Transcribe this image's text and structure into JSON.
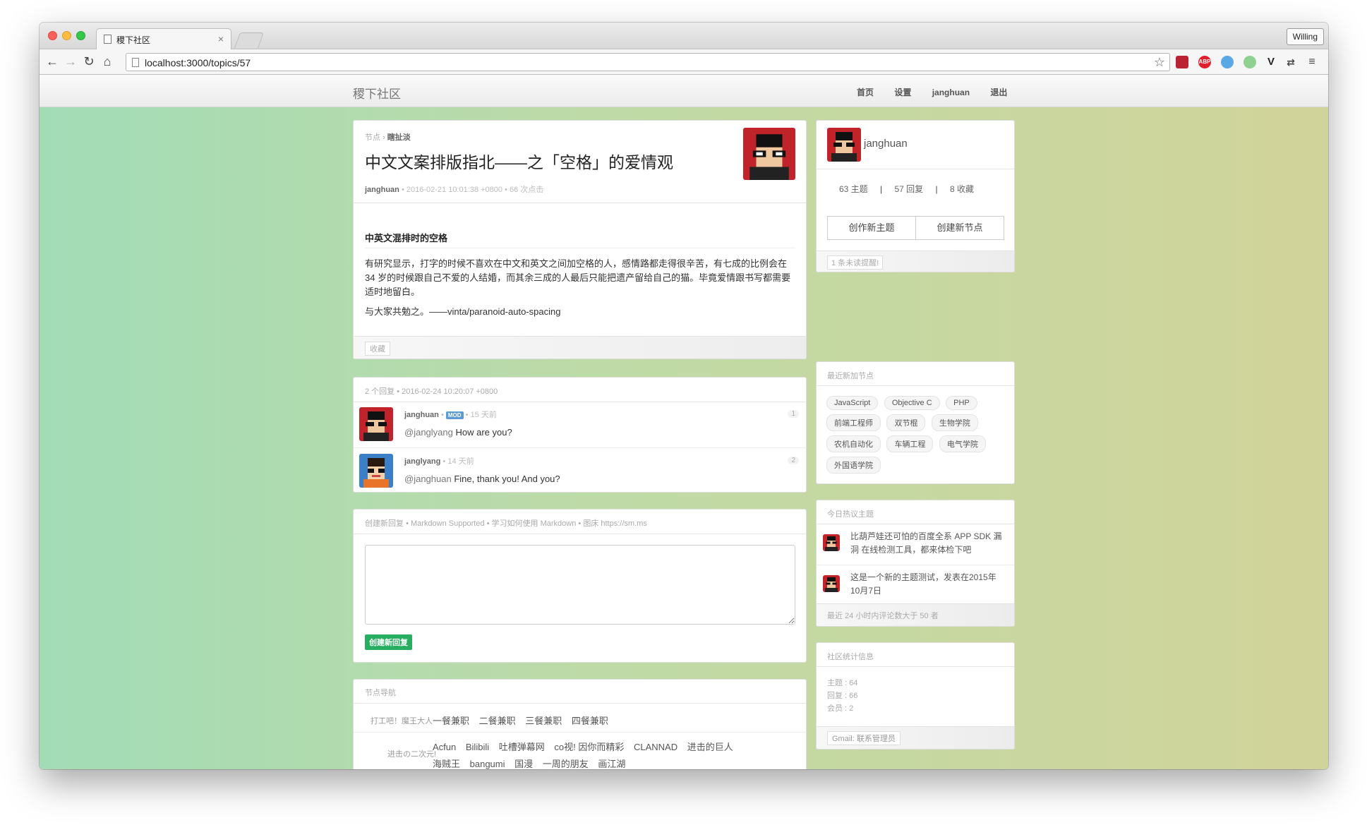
{
  "browser": {
    "tab_title": "稷下社区",
    "tab_close": "×",
    "profile_name": "Willing",
    "url": "localhost:3000/topics/57",
    "ext_labels": [
      "ABP",
      "V"
    ]
  },
  "site": {
    "brand": "稷下社区",
    "nav": [
      "首页",
      "设置",
      "janghuan",
      "退出"
    ]
  },
  "topic": {
    "crumb_root": "节点",
    "crumb_sep": "›",
    "crumb_node": "瞎扯淡",
    "title": "中文文案排版指北——之「空格」的爱情观",
    "author": "janghuan",
    "time": "2016-02-21 10:01:38 +0800",
    "views": "66 次点击",
    "heading": "中英文混排时的空格",
    "para1": "有研究显示，打字的时候不喜欢在中文和英文之间加空格的人，感情路都走得很辛苦，有七成的比例会在 34 岁的时候跟自己不爱的人结婚，而其余三成的人最后只能把遗产留给自己的猫。毕竟爱情跟书写都需要适时地留白。",
    "para2": "与大家共勉之。——vinta/paranoid-auto-spacing",
    "favorite": "收藏"
  },
  "replies": {
    "count": "2 个回复",
    "last_time": "2016-02-24 10:20:07 +0800",
    "items": [
      {
        "user": "janghuan",
        "badge": "MOD",
        "time": "15 天前",
        "mention": "@janglyang",
        "text": " How are you?",
        "num": "1"
      },
      {
        "user": "janglyang",
        "time": "14 天前",
        "mention": "@janghuan",
        "text": " Fine, thank you! And you?",
        "num": "2"
      }
    ]
  },
  "new_reply": {
    "title": "创建新回复",
    "md": "Markdown Supported",
    "learn": "学习如何使用 Markdown",
    "img": "图床 https://sm.ms",
    "submit": "创建新回复"
  },
  "node_nav": {
    "title": "节点导航",
    "groups": [
      {
        "label": "打工吧！魔王大人",
        "links": [
          "一餐兼职",
          "二餐兼职",
          "三餐兼职",
          "四餐兼职"
        ]
      },
      {
        "label": "进击の二次元!",
        "links_line1": [
          "Acfun",
          "Bilibili",
          "吐槽弹幕网",
          "co视! 因你而精彩",
          "CLANNAD",
          "进击的巨人"
        ],
        "links_line2": [
          "海贼王",
          "bangumi",
          "国漫",
          "一周的朋友",
          "画江湖"
        ]
      }
    ]
  },
  "profile": {
    "name": "janghuan",
    "topics": "63 主题",
    "replies": "57 回复",
    "favorites": "8 收藏",
    "sep": "|",
    "new_topic": "创作新主题",
    "new_node": "创建新节点",
    "notice": "1 条未读提醒!"
  },
  "recent_nodes": {
    "title": "最近新加节点",
    "items": [
      "JavaScript",
      "Objective C",
      "PHP",
      "前端工程师",
      "双节棍",
      "生物学院",
      "农机自动化",
      "车辆工程",
      "电气学院",
      "外国语学院"
    ]
  },
  "hot_topics": {
    "title": "今日热议主题",
    "items": [
      "比葫芦娃还可怕的百度全系 APP SDK 漏洞 在线检测工具，都来体检下吧",
      "这是一个新的主题测试，发表在2015年10月7日"
    ],
    "footer": "最近 24 小时内评论数大于 50 者"
  },
  "community_stats": {
    "title": "社区统计信息",
    "topics": "主题 : 64",
    "replies": "回复 : 66",
    "members": "会员 : 2",
    "contact": "Gmail: 联系管理员"
  },
  "colors": {
    "accent_green": "#27ae60",
    "mod_blue": "#5c9bd8",
    "bg_left": "#a2dcb7",
    "bg_right": "#d1d49a"
  }
}
